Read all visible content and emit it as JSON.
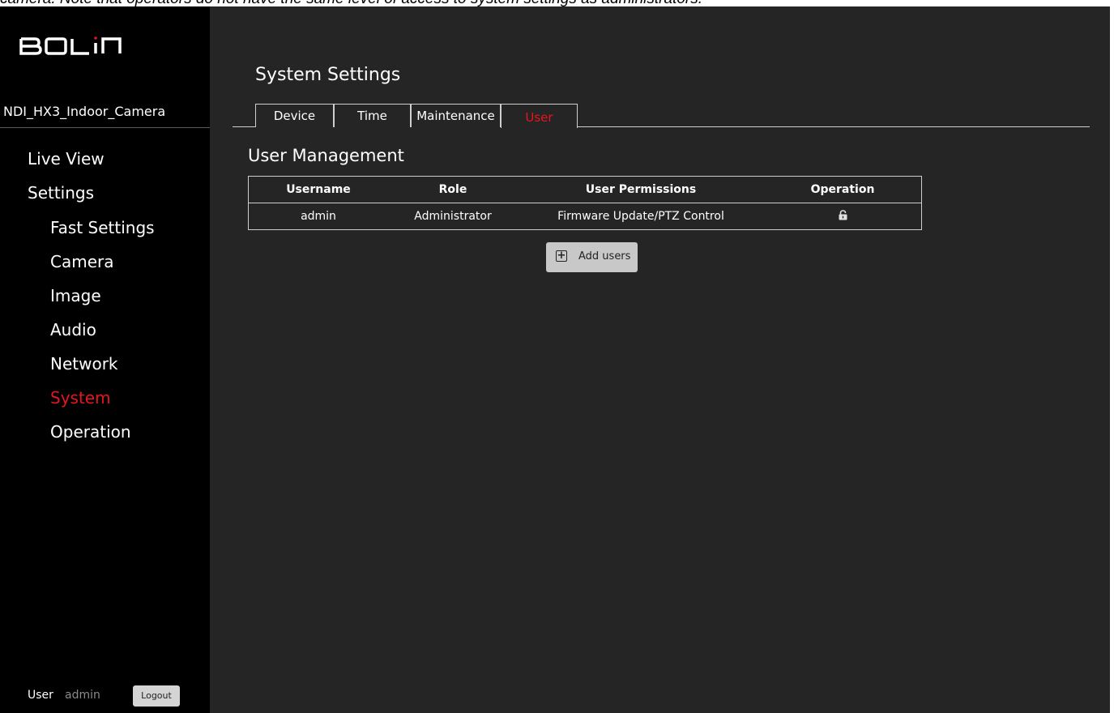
{
  "caption": "camera. Note that operators do not have the same level of access to system settings as administrators.",
  "brand": {
    "logo_text": "BOLIN",
    "icon": "bolin-logo"
  },
  "device_name": "NDI_HX3_Indoor_Camera",
  "nav": {
    "items": [
      {
        "label": "Live View",
        "level": 0
      },
      {
        "label": "Settings",
        "level": 0
      },
      {
        "label": "Fast Settings",
        "level": 1
      },
      {
        "label": "Camera",
        "level": 1
      },
      {
        "label": "Image",
        "level": 1
      },
      {
        "label": "Audio",
        "level": 1
      },
      {
        "label": "Network",
        "level": 1
      },
      {
        "label": "System",
        "level": 1,
        "active": true
      },
      {
        "label": "Operation",
        "level": 1
      }
    ]
  },
  "user_bar": {
    "label": "User",
    "name": "admin",
    "logout_label": "Logout"
  },
  "page": {
    "title": "System Settings",
    "tabs": [
      {
        "label": "Device"
      },
      {
        "label": "Time"
      },
      {
        "label": "Maintenance"
      },
      {
        "label": "User",
        "active": true
      }
    ],
    "section_title": "User Management",
    "table": {
      "headers": [
        "Username",
        "Role",
        "User Permissions",
        "Operation"
      ],
      "rows": [
        {
          "username": "admin",
          "role": "Administrator",
          "permissions": "Firmware Update/PTZ Control",
          "operation_icon": "lock-icon"
        }
      ]
    },
    "add_users_label": "Add users"
  },
  "colors": {
    "active": "#e8141f",
    "sidebar_bg": "#000000",
    "main_bg": "#252525"
  }
}
